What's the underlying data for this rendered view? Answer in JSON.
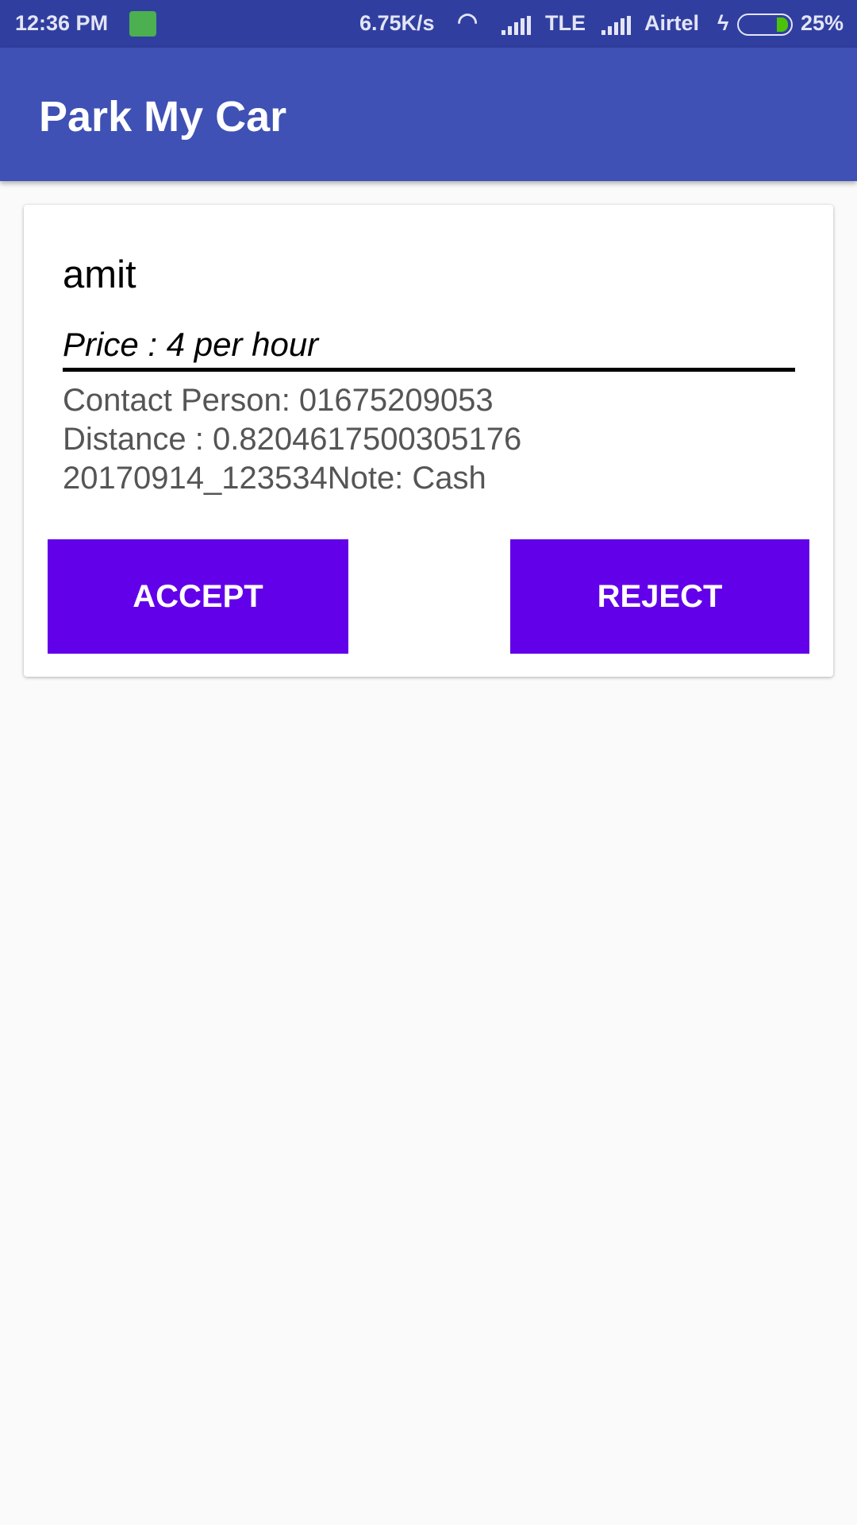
{
  "status_bar": {
    "time": "12:36 PM",
    "speed": "6.75K/s",
    "network1": "TLE",
    "carrier": "Airtel",
    "battery": "25%",
    "battery_level": 25
  },
  "app_bar": {
    "title": "Park My Car"
  },
  "card": {
    "name": "amit",
    "price": "Price : 4 per hour",
    "contact": "Contact Person: 01675209053",
    "distance": "Distance : 0.8204617500305176",
    "note": "20170914_123534Note: Cash",
    "accept_label": "ACCEPT",
    "reject_label": "REJECT"
  },
  "colors": {
    "status": "#303f9f",
    "primary": "#3f51b5",
    "button": "#6200ea"
  }
}
